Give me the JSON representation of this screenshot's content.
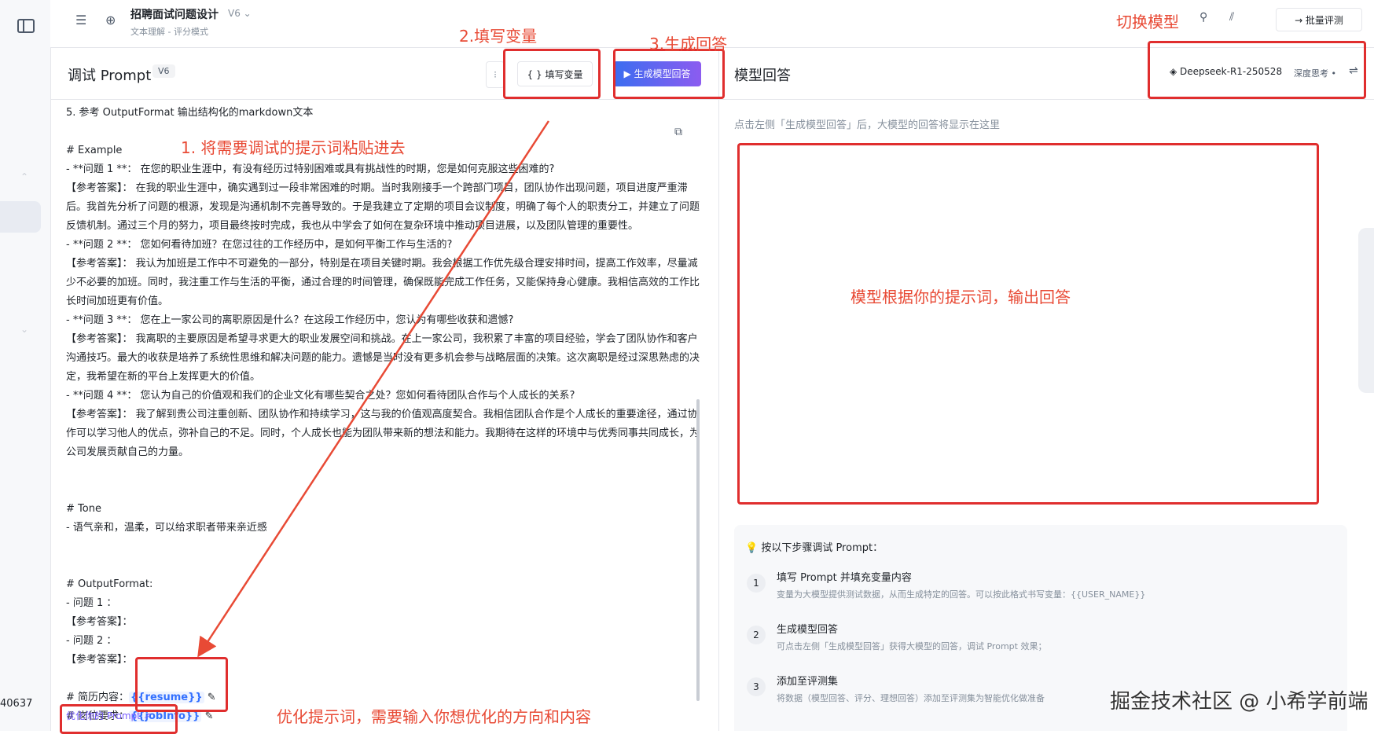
{
  "topbar": {
    "doc_title": "招聘面试问题设计",
    "version": "V6 ⌄",
    "subtitle": "文本理解 - 评分模式",
    "batch_label": "→  批量评测"
  },
  "left_panel": {
    "title": "调试 Prompt",
    "version_badge": "V6",
    "fill_vars_label": "{ }  填写变量",
    "generate_label": "▶  生成模型回答",
    "optimize_label": "优化你的 Prompt ⇗"
  },
  "editor": {
    "lines": [
      "  5. 参考 OutputFormat 输出结构化的markdown文本",
      "",
      "  # Example",
      "  - **问题 1 **：  在您的职业生涯中，有没有经历过特别困难或具有挑战性的时期，您是如何克服这些困难的?",
      "    【参考答案】：  在我的职业生涯中，确实遇到过一段非常困难的时期。当时我刚接手一个跨部门项目，团队协作出现问题，项目进度严重滞后。我首先分析了问题的根源，发现是沟通机制不完善导致的。于是我建立了定期的项目会议制度，明确了每个人的职责分工，并建立了问题反馈机制。通过三个月的努力，项目最终按时完成，我也从中学会了如何在复杂环境中推动项目进展，以及团队管理的重要性。",
      "  - **问题 2 **：  您如何看待加班？在您过往的工作经历中，是如何平衡工作与生活的?",
      "    【参考答案】：  我认为加班是工作中不可避免的一部分，特别是在项目关键时期。我会根据工作优先级合理安排时间，提高工作效率，尽量减少不必要的加班。同时，我注重工作与生活的平衡，通过合理的时间管理，确保既能完成工作任务，又能保持身心健康。我相信高效的工作比长时间加班更有价值。",
      "  - **问题 3 **：  您在上一家公司的离职原因是什么？在这段工作经历中，您认为有哪些收获和遗憾?",
      "    【参考答案】：  我离职的主要原因是希望寻求更大的职业发展空间和挑战。在上一家公司，我积累了丰富的项目经验，学会了团队协作和客户沟通技巧。最大的收获是培养了系统性思维和解决问题的能力。遗憾是当时没有更多机会参与战略层面的决策。这次离职是经过深思熟虑的决定，我希望在新的平台上发挥更大的价值。",
      "  - **问题 4 **：  您认为自己的价值观和我们的企业文化有哪些契合之处？您如何看待团队合作与个人成长的关系?",
      "    【参考答案】：  我了解到贵公司注重创新、团队协作和持续学习，这与我的价值观高度契合。我相信团队合作是个人成长的重要途径，通过协作可以学习他人的优点，弥补自己的不足。同时，个人成长也能为团队带来新的想法和能力。我期待在这样的环境中与优秀同事共同成长，为公司发展贡献自己的力量。",
      "",
      "",
      "  # Tone",
      "  - 语气亲和，温柔，可以给求职者带来亲近感",
      "",
      "",
      "  # OutputFormat:",
      "  - 问题 1  ：",
      "    【参考答案】：",
      "  - 问题 2  ：",
      "    【参考答案】：",
      "",
      "  # 简历内容："
    ],
    "var_resume": "{{resume}}",
    "var_job_prefix": "  # 岗位要求：",
    "var_job": "{{jobInfo}}"
  },
  "right_panel": {
    "title": "模型回答",
    "model_name": "◈  Deepseek-R1-250528",
    "deep_think": "深度思考 •",
    "hint": "点击左侧「生成模型回答」后，大模型的回答将显示在这里"
  },
  "guide": {
    "title": "💡 按以下步骤调试 Prompt：",
    "steps": [
      {
        "num": "1",
        "title": "填写 Prompt 并填充变量内容",
        "desc": "变量为大模型提供测试数据，从而生成特定的回答。可以按此格式书写变量：{{USER_NAME}}"
      },
      {
        "num": "2",
        "title": "生成模型回答",
        "desc": "可点击左侧「生成模型回答」获得大模型的回答，调试 Prompt 效果；"
      },
      {
        "num": "3",
        "title": "添加至评测集",
        "desc": "将数据（模型回答、评分、理想回答）添加至评测集为智能优化做准备"
      }
    ]
  },
  "annotations": {
    "paste": "1. 将需要调试的提示词粘贴进去",
    "fill": "2.填写变量",
    "generate": "3.生成回答",
    "switch_model": "切换模型",
    "output": "模型根据你的提示词，输出回答",
    "optimize": "优化提示词，需要输入你想优化的方向和内容"
  },
  "sidebar": {
    "tail_text": "40637"
  },
  "watermark": "掘金技术社区 @ 小希学前端",
  "colors": {
    "accent": "#3370ff",
    "annotation_red": "#e02e2e",
    "optimize_purple": "#7b61ff"
  }
}
